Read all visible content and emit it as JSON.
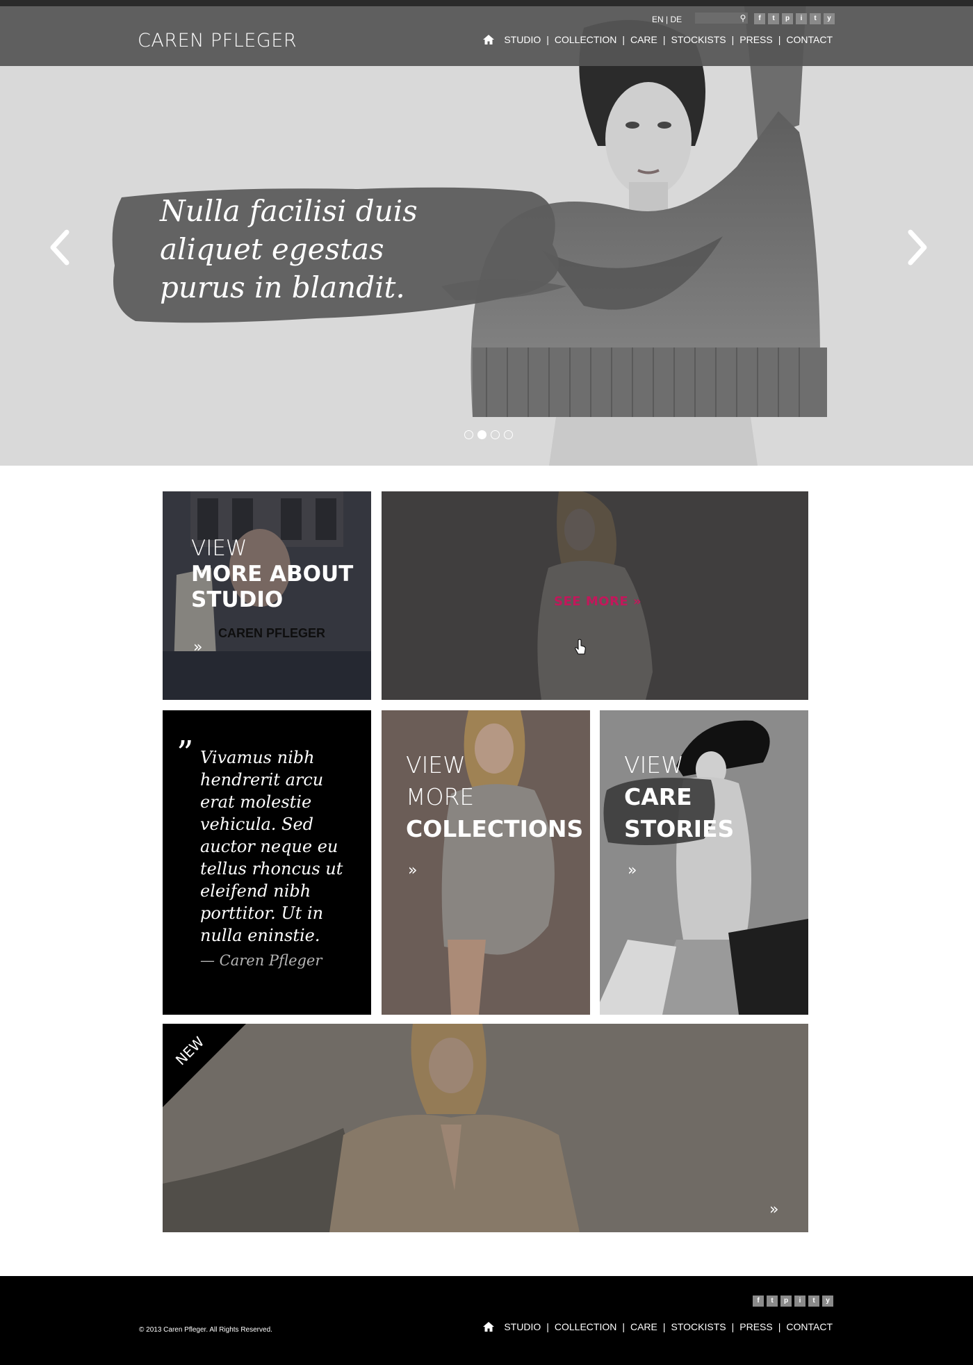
{
  "header": {
    "logo": "CAREN PFLEGER",
    "lang": "EN | DE",
    "search_placeholder": "",
    "social": [
      "f",
      "t",
      "p",
      "i",
      "t",
      "y"
    ],
    "nav": [
      "STUDIO",
      "COLLECTION",
      "CARE",
      "STOCKISTS",
      "PRESS",
      "CONTACT"
    ]
  },
  "hero": {
    "lines": [
      "Nulla facilisi duis",
      "aliquet egestas",
      "purus in blandit."
    ],
    "slides": 4,
    "active_slide": 2
  },
  "tiles": {
    "studio": {
      "line1": "VIEW",
      "line2": "MORE ABOUT",
      "line3": "STUDIO",
      "chevron": "»",
      "sign_text": "CAREN PFLEGER"
    },
    "featured": {
      "see_more": "SEE MORE »"
    },
    "quote": {
      "mark": "”",
      "text": "Vivamus nibh hendrerit arcu erat molestie vehicula. Sed auctor neque eu tellus rhoncus ut eleifend nibh porttitor. Ut in nulla eninstie.",
      "author": "— Caren Pfleger"
    },
    "collections": {
      "line1": "VIEW",
      "line2": "MORE",
      "line3": "COLLECTIONS",
      "chevron": "»"
    },
    "care": {
      "line1": "VIEW",
      "line2": "CARE",
      "line3": "STORIES",
      "chevron": "»"
    },
    "new": {
      "badge": "NEW",
      "chevron": "»"
    }
  },
  "footer": {
    "copyright": "© 2013 Caren Pfleger. All Rights Reserved.",
    "nav": [
      "STUDIO",
      "COLLECTION",
      "CARE",
      "STOCKISTS",
      "PRESS",
      "CONTACT"
    ]
  },
  "colors": {
    "header": "#555555",
    "accent": "#c2185b",
    "footer": "#000000"
  }
}
